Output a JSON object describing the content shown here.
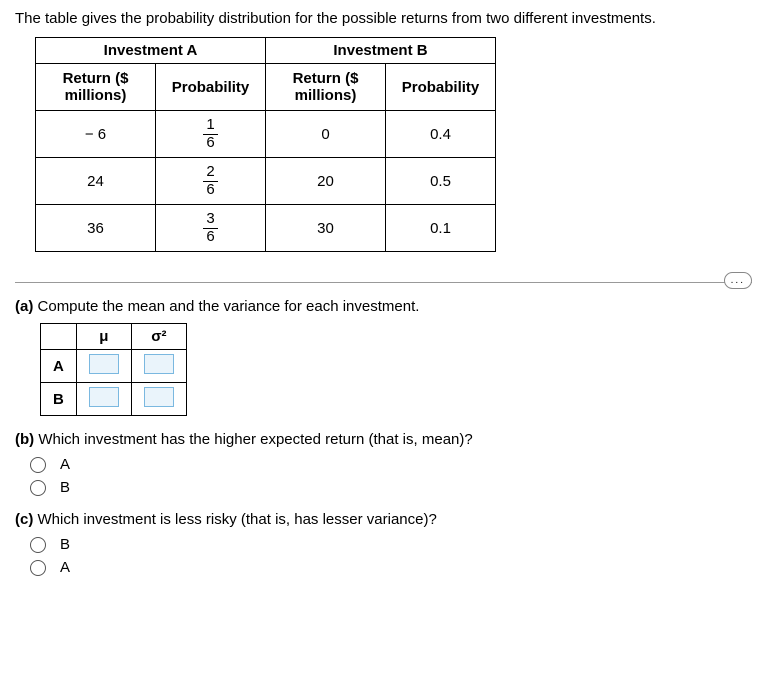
{
  "intro": "The table gives the probability distribution for the possible returns from two different investments.",
  "table": {
    "groupA": "Investment A",
    "groupB": "Investment B",
    "colReturn": "Return ($ millions)",
    "colProb": "Probability",
    "A": {
      "rows": [
        {
          "ret": "− 6",
          "prob_num": "1",
          "prob_den": "6"
        },
        {
          "ret": "24",
          "prob_num": "2",
          "prob_den": "6"
        },
        {
          "ret": "36",
          "prob_num": "3",
          "prob_den": "6"
        }
      ]
    },
    "B": {
      "rows": [
        {
          "ret": "0",
          "prob": "0.4"
        },
        {
          "ret": "20",
          "prob": "0.5"
        },
        {
          "ret": "30",
          "prob": "0.1"
        }
      ]
    }
  },
  "qa": {
    "label": "(a)",
    "text": "Compute the mean and the variance for each investment.",
    "mu": "μ",
    "sigma2": "σ²",
    "rowA": "A",
    "rowB": "B"
  },
  "qb": {
    "label": "(b)",
    "text": "Which investment has the higher expected return (that is, mean)?",
    "opt1": "A",
    "opt2": "B"
  },
  "qc": {
    "label": "(c)",
    "text": "Which investment is less risky (that is, has lesser variance)?",
    "opt1": "B",
    "opt2": "A"
  },
  "more": "..."
}
